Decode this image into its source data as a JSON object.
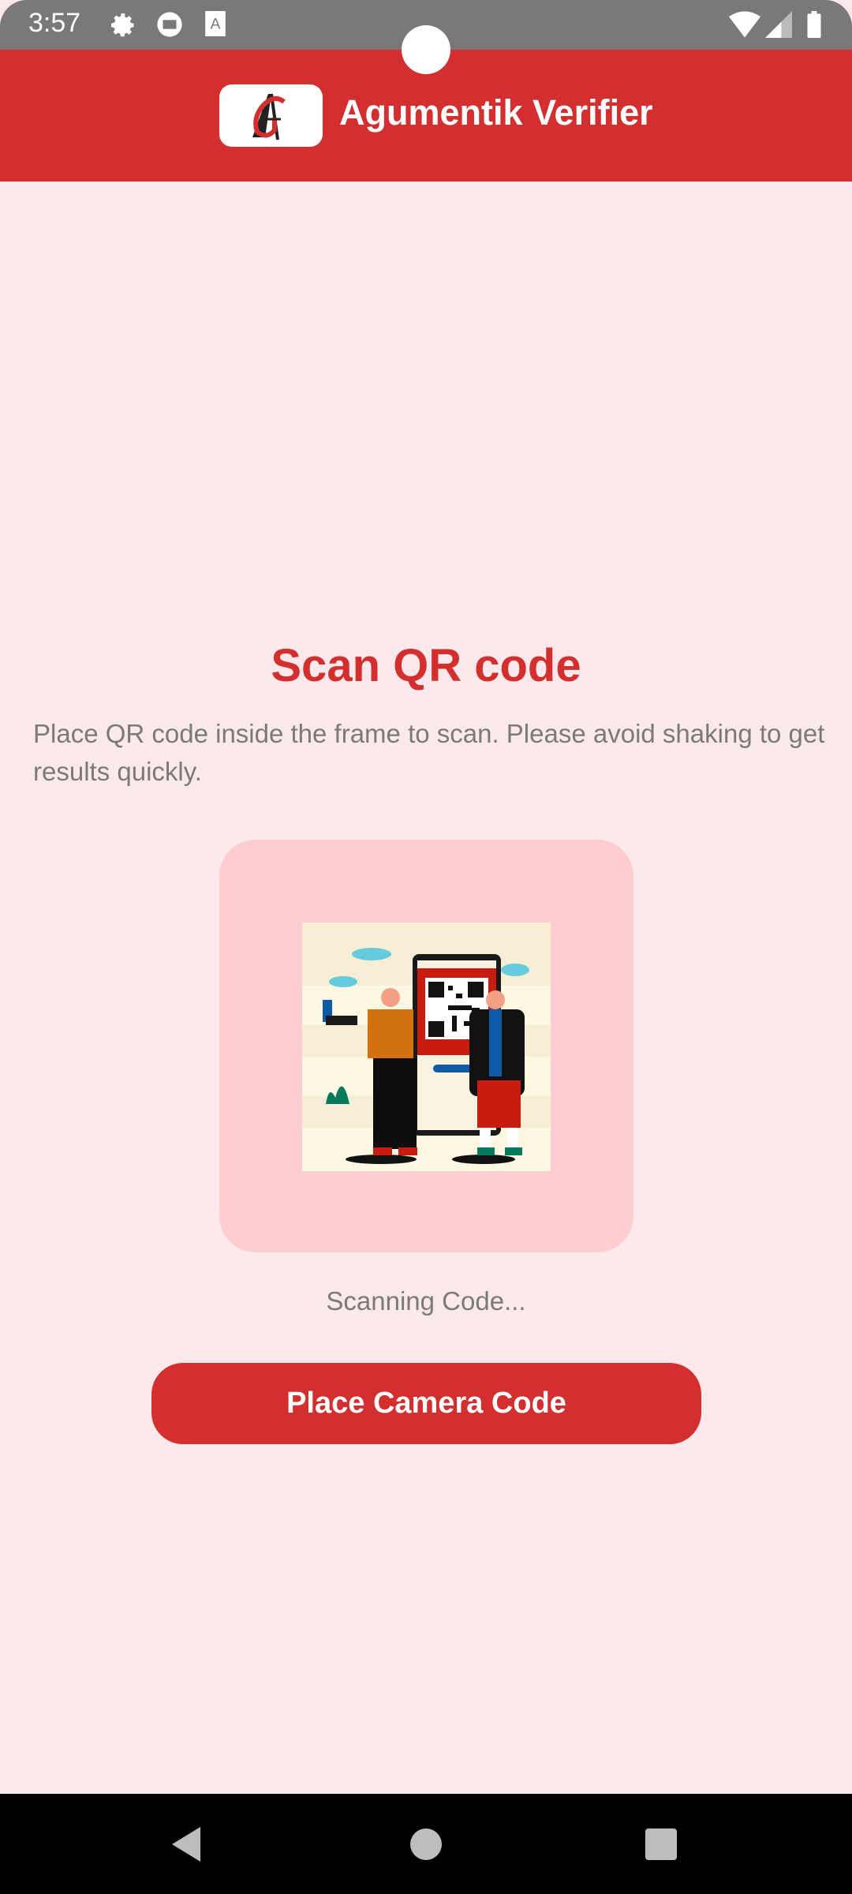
{
  "status_bar": {
    "time": "3:57",
    "icons": [
      "gear-icon",
      "cast-icon",
      "keyboard-a-icon",
      "wifi-icon",
      "signal-icon",
      "battery-icon"
    ]
  },
  "header": {
    "app_title": "Agumentik Verifier",
    "logo_letters": "AG"
  },
  "main": {
    "title": "Scan QR code",
    "description": "Place QR code inside the frame to scan. Please avoid shaking to get results quickly.",
    "scanning_status": "Scanning Code...",
    "button_label": "Place Camera Code"
  },
  "colors": {
    "primary": "#d32f2f",
    "background": "#fde9eb",
    "card": "#fecdd2",
    "muted_text": "#7a7a7a"
  },
  "nav_bar": {
    "icons": [
      "back-icon",
      "home-icon",
      "recents-icon"
    ]
  }
}
